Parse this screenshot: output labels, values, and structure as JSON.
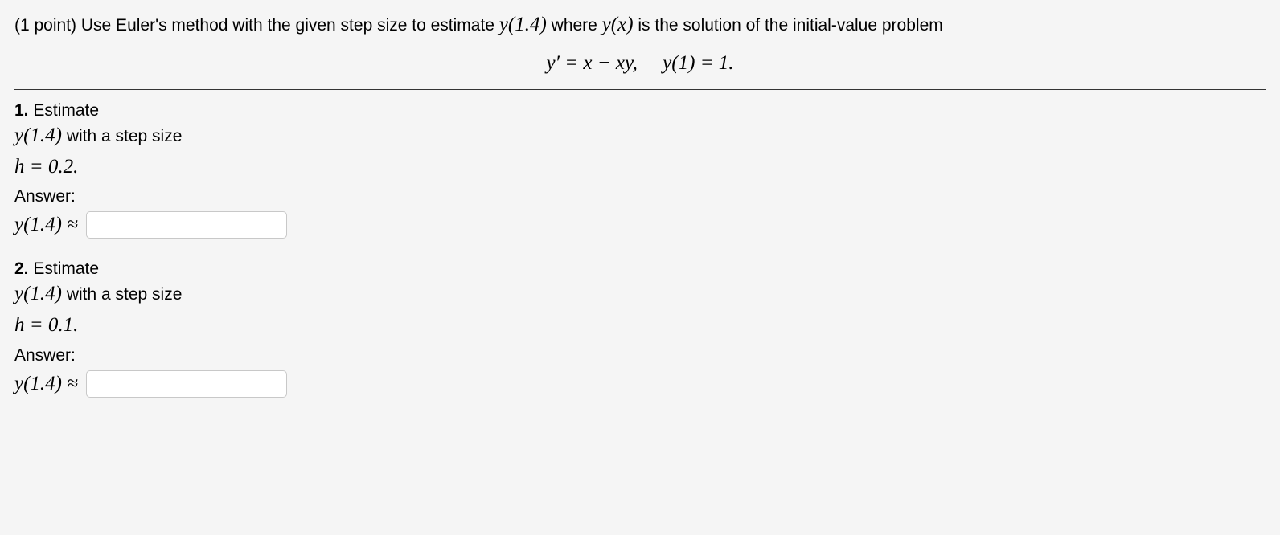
{
  "intro": {
    "points": "(1 point)",
    "text_a": " Use Euler's method with the given step size to estimate ",
    "y_target": "y(1.4)",
    "text_b": " where ",
    "y_of_x": "y(x)",
    "text_c": " is the solution of the initial-value problem"
  },
  "equation": {
    "ode": "y′ = x − xy,",
    "ic": "y(1) = 1."
  },
  "parts": [
    {
      "num": "1.",
      "label": "Estimate",
      "target": "y(1.4)",
      "with_text": " with a step size",
      "step": "h = 0.2.",
      "answer_label": "Answer:",
      "answer_expr": "y(1.4) ≈",
      "value": "",
      "placeholder": ""
    },
    {
      "num": "2.",
      "label": "Estimate",
      "target": "y(1.4)",
      "with_text": " with a step size",
      "step": "h = 0.1.",
      "answer_label": "Answer:",
      "answer_expr": "y(1.4) ≈",
      "value": "",
      "placeholder": ""
    }
  ]
}
